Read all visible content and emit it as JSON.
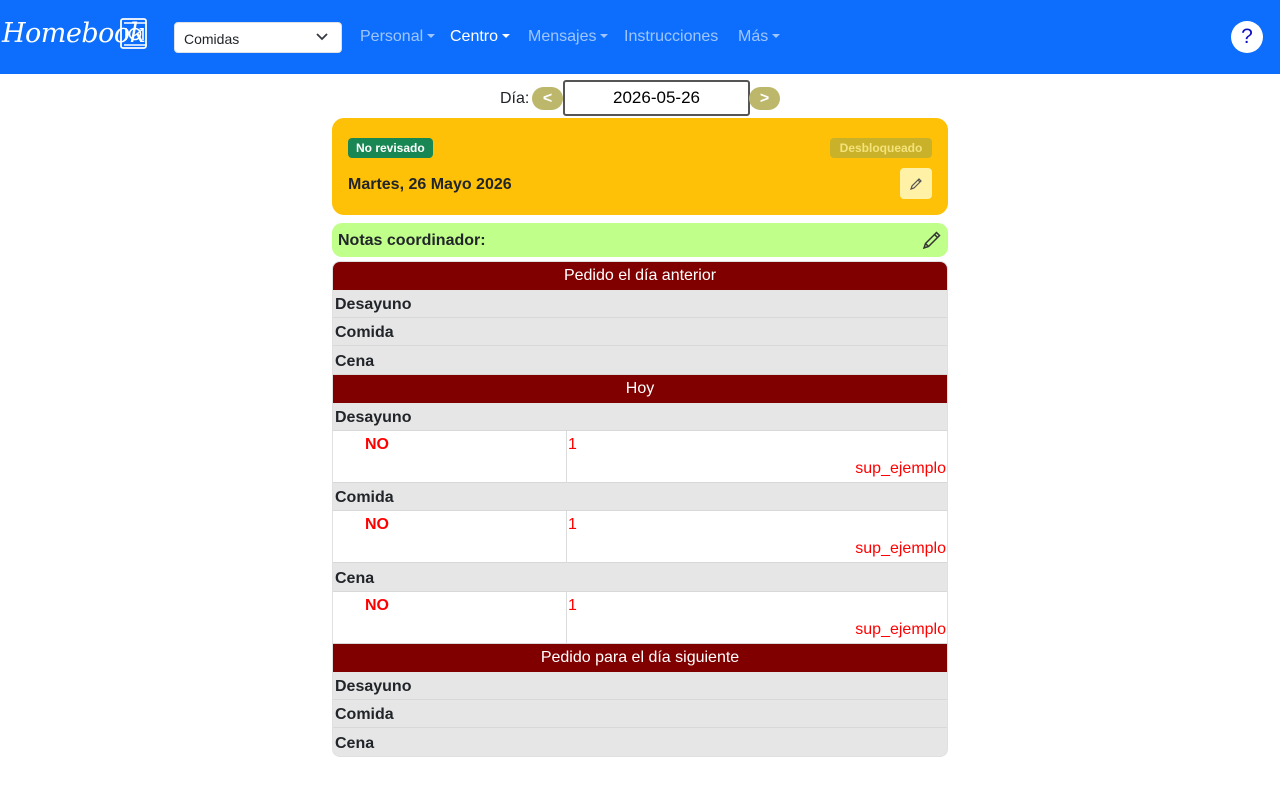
{
  "navbar": {
    "brand": "Homebook",
    "brand_icon": "plate-book-icon",
    "select_value": "Comidas",
    "items": [
      {
        "label": "Personal",
        "dropdown": true,
        "active": false
      },
      {
        "label": "Centro",
        "dropdown": true,
        "active": true
      },
      {
        "label": "Mensajes",
        "dropdown": true,
        "active": false
      },
      {
        "label": "Instrucciones",
        "dropdown": false,
        "active": false
      },
      {
        "label": "Más",
        "dropdown": true,
        "active": false
      }
    ],
    "help_label": "?"
  },
  "date_picker": {
    "label": "Día:",
    "prev": "<",
    "next": ">",
    "value": "2026-05-26"
  },
  "day_card": {
    "status_badge": "No revisado",
    "lock_badge": "Desbloqueado",
    "title": "Martes, 26 Mayo 2026"
  },
  "notes": {
    "label": "Notas coordinador:"
  },
  "sections": [
    {
      "title": "Pedido el día anterior",
      "meals": [
        {
          "name": "Desayuno"
        },
        {
          "name": "Comida"
        },
        {
          "name": "Cena"
        }
      ]
    },
    {
      "title": "Hoy",
      "meals": [
        {
          "name": "Desayuno",
          "detail": {
            "answer": "NO",
            "qty": "1",
            "user": "sup_ejemplo"
          }
        },
        {
          "name": "Comida",
          "detail": {
            "answer": "NO",
            "qty": "1",
            "user": "sup_ejemplo"
          }
        },
        {
          "name": "Cena",
          "detail": {
            "answer": "NO",
            "qty": "1",
            "user": "sup_ejemplo"
          }
        }
      ]
    },
    {
      "title": "Pedido para el día siguiente",
      "meals": [
        {
          "name": "Desayuno"
        },
        {
          "name": "Comida"
        },
        {
          "name": "Cena"
        }
      ]
    }
  ],
  "colors": {
    "navbar": "#0d6efd",
    "section_header": "#800000",
    "day_card": "#ffc107",
    "notes_card": "#c0ff8a",
    "badge_green": "#198754",
    "alert_red": "#ff0000"
  }
}
